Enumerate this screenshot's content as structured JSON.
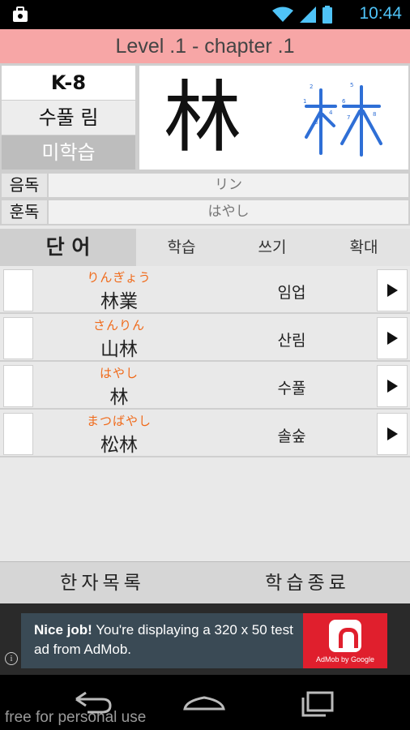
{
  "status_bar": {
    "time": "10:44",
    "icons": [
      "bag-icon",
      "wifi-icon",
      "signal-icon",
      "battery-icon"
    ]
  },
  "header": {
    "title": "Level .1 - chapter .1"
  },
  "kanji_card": {
    "code": "K-8",
    "meaning": "수풀 림",
    "status": "미학습",
    "character": "林",
    "stroke_character": "林"
  },
  "readings": {
    "onyomi_label": "음독",
    "onyomi_value": "リン",
    "kunyomi_label": "훈독",
    "kunyomi_value": "はやし"
  },
  "tabs": [
    {
      "label": "단 어"
    },
    {
      "label": "학습"
    },
    {
      "label": "쓰기"
    },
    {
      "label": "확대"
    }
  ],
  "words": [
    {
      "furigana": "りんぎょう",
      "kanji": "林業",
      "meaning": "임업"
    },
    {
      "furigana": "さんりん",
      "kanji": "山林",
      "meaning": "산림"
    },
    {
      "furigana": "はやし",
      "kanji": "林",
      "meaning": "수풀"
    },
    {
      "furigana": "まつばやし",
      "kanji": "松林",
      "meaning": "솔숲"
    }
  ],
  "bottom_bar": {
    "list_label": "한자목록",
    "end_label": "학습종료"
  },
  "ad": {
    "headline": "Nice job!",
    "body": " You're displaying a 320 x 50 test ad from AdMob.",
    "logo_text": "AdMob by Google",
    "info": "i"
  },
  "watermark": "free for personal use",
  "colors": {
    "header_bg": "#f7a6a6",
    "furigana": "#f06a1a",
    "stroke_blue": "#2f6fd6",
    "time": "#4fc3f7",
    "ad_red": "#e01f2d"
  }
}
